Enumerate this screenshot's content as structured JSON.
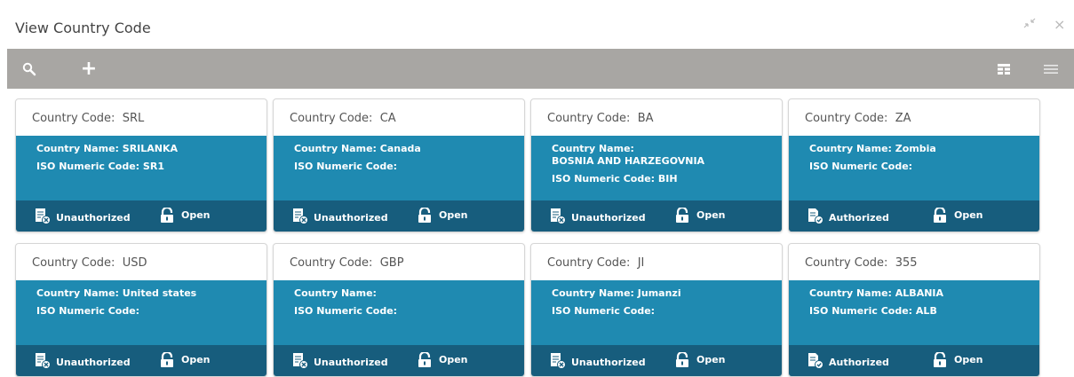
{
  "window": {
    "title": "View Country Code"
  },
  "toolbar": {
    "add_label": "+"
  },
  "labels": {
    "code": "Country Code:",
    "name": "Country Name:",
    "iso": "ISO Numeric Code:"
  },
  "tiles": [
    {
      "code": "SRL",
      "name": "SRILANKA",
      "iso": "SR1",
      "auth": "Unauthorized",
      "lock": "Open"
    },
    {
      "code": "CA",
      "name": "Canada",
      "iso": "",
      "auth": "Unauthorized",
      "lock": "Open"
    },
    {
      "code": "BA",
      "name": "BOSNIA AND HARZEGOVNIA",
      "iso": "BIH",
      "auth": "Unauthorized",
      "lock": "Open"
    },
    {
      "code": "ZA",
      "name": "Zombia",
      "iso": "",
      "auth": "Authorized",
      "lock": "Open"
    },
    {
      "code": "USD",
      "name": "United states",
      "iso": "",
      "auth": "Unauthorized",
      "lock": "Open"
    },
    {
      "code": "GBP",
      "name": "",
      "iso": "",
      "auth": "Unauthorized",
      "lock": "Open"
    },
    {
      "code": "JI",
      "name": "Jumanzi",
      "iso": "",
      "auth": "Unauthorized",
      "lock": "Open"
    },
    {
      "code": "355",
      "name": "ALBANIA",
      "iso": "ALB",
      "auth": "Authorized",
      "lock": "Open"
    }
  ],
  "colors": {
    "toolbar": "#a8a6a3",
    "tile_body": "#1f8ab1",
    "tile_footer": "#175d7d"
  },
  "icons": {
    "search": "search-icon",
    "add": "plus-icon",
    "grid": "grid-view-icon",
    "list": "list-view-icon",
    "unauthorized": "document-unauthorized-icon",
    "authorized": "document-authorized-icon",
    "lock": "unlock-icon",
    "minimize": "minimize-icon",
    "close": "close-icon"
  }
}
